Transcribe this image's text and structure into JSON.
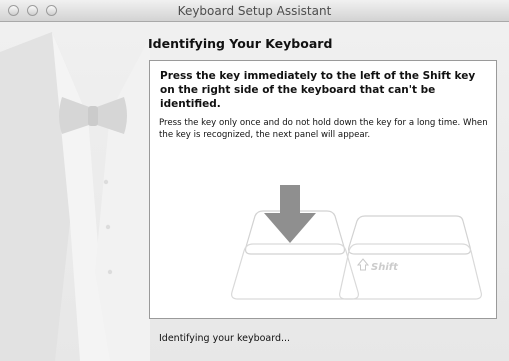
{
  "window": {
    "title": "Keyboard Setup Assistant"
  },
  "heading": "Identifying Your Keyboard",
  "panel": {
    "instruction": "Press the key immediately to the left of the Shift key on the right side of the keyboard that can't be identified.",
    "detail": "Press the key only once and do not hold down the key for a long time. When the key is recognized, the next panel will appear.",
    "shift_label": "Shift"
  },
  "status": "Identifying your keyboard...",
  "colors": {
    "arrow": "#8f8f8f",
    "key_outline": "#cfcfcf",
    "panel_bg": "#ffffff",
    "window_bg": "#ececec"
  },
  "icons": {
    "arrow": "down-arrow-icon",
    "shift": "shift-arrow-icon"
  }
}
